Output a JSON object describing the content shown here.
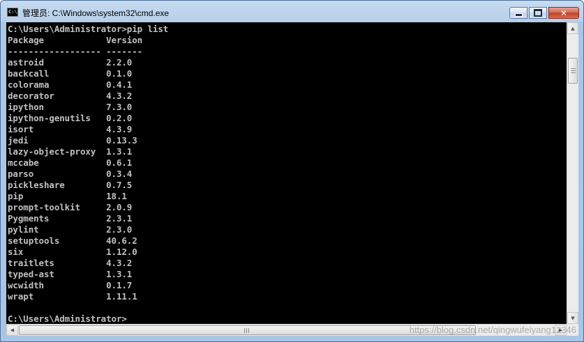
{
  "window": {
    "title": "管理员: C:\\Windows\\system32\\cmd.exe",
    "app_icon_text": "C:\\",
    "controls": {
      "minimize": "",
      "maximize": "",
      "close": "✕"
    }
  },
  "console": {
    "lines": [
      "C:\\Users\\Administrator>pip list",
      "Package            Version",
      "------------------ -------",
      "astroid            2.2.0",
      "backcall           0.1.0",
      "colorama           0.4.1",
      "decorator          4.3.2",
      "ipython            7.3.0",
      "ipython-genutils   0.2.0",
      "isort              4.3.9",
      "jedi               0.13.3",
      "lazy-object-proxy  1.3.1",
      "mccabe             0.6.1",
      "parso              0.3.4",
      "pickleshare        0.7.5",
      "pip                18.1",
      "prompt-toolkit     2.0.9",
      "Pygments           2.3.1",
      "pylint             2.3.0",
      "setuptools         40.6.2",
      "six                1.12.0",
      "traitlets          4.3.2",
      "typed-ast          1.3.1",
      "wcwidth            0.1.7",
      "wrapt              1.11.1",
      "",
      "C:\\Users\\Administrator>"
    ]
  },
  "scrollbars": {
    "up_arrow": "▲",
    "down_arrow": "▼",
    "left_arrow": "◀",
    "right_arrow": "▶",
    "hthumb_grip": "III"
  },
  "watermark": "https://blog.csdn.net/qingwufeiyang12346"
}
